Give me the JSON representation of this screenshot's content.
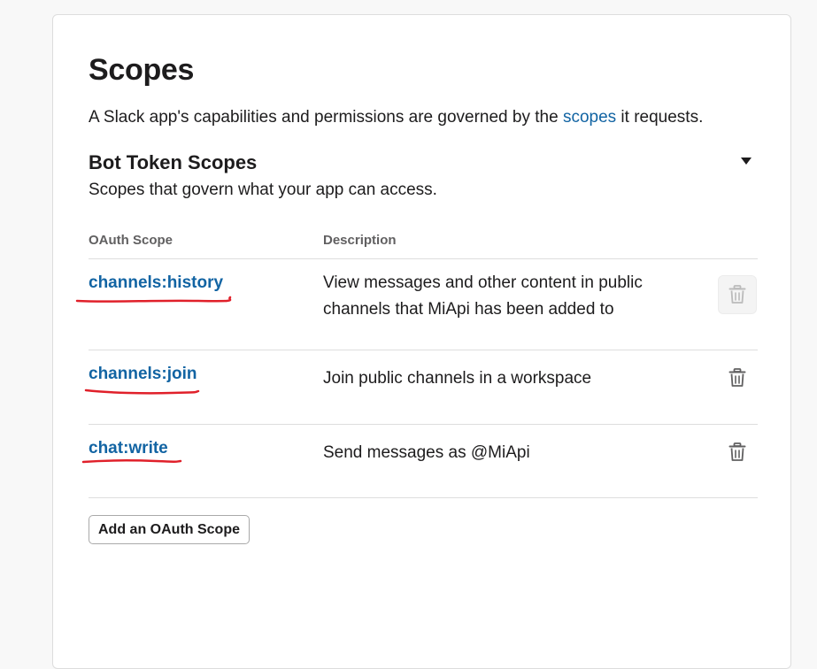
{
  "page": {
    "title": "Scopes",
    "intro_before": "A Slack app's capabilities and permissions are governed by the ",
    "intro_link": "scopes",
    "intro_after": " it requests."
  },
  "bot_scopes": {
    "title": "Bot Token Scopes",
    "subtitle": "Scopes that govern what your app can access.",
    "collapse_icon": "caret-down-icon",
    "columns": {
      "scope": "OAuth Scope",
      "description": "Description"
    },
    "rows": [
      {
        "scope": "channels:history",
        "description": "View messages and other content in public channels that MiApi has been added to",
        "remove_disabled": true
      },
      {
        "scope": "channels:join",
        "description": "Join public channels in a workspace",
        "remove_disabled": false
      },
      {
        "scope": "chat:write",
        "description": "Send messages as @MiApi",
        "remove_disabled": false
      }
    ],
    "add_button": "Add an OAuth Scope"
  },
  "colors": {
    "link": "#1264a3",
    "annotation_underline": "#e0202a",
    "trash_icon": "#616061",
    "trash_icon_disabled": "#bbbbbb"
  }
}
